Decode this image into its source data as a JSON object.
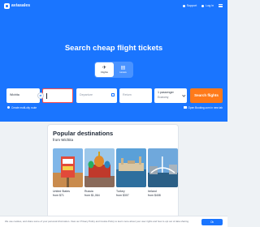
{
  "brand": {
    "name": "aviasales",
    "accent": "#1a75ff",
    "cta": "#ff7a1a"
  },
  "topbar": {
    "support_label": "Support",
    "account_label": "Log in"
  },
  "hero": {
    "headline": "Search cheap flight tickets"
  },
  "mode_tabs": [
    {
      "label": "Flights",
      "icon": "plane-icon",
      "active": true
    },
    {
      "label": "Hotels",
      "icon": "hotel-icon",
      "active": false
    }
  ],
  "search": {
    "from_value": "Wichita",
    "to_placeholder": "",
    "depart_placeholder": "Departure",
    "return_placeholder": "Return",
    "passengers_value": "1 passenger",
    "cabin_value": "Economy",
    "button_label": "Search flights"
  },
  "options": {
    "multi_city_label": "Create multi-city route",
    "booking_label": "Open Booking.com in new tab",
    "booking_checked": true
  },
  "popular": {
    "title": "Popular destinations",
    "subtitle": "from Wichita",
    "items": [
      {
        "name": "United States",
        "price": "from $71"
      },
      {
        "name": "Russia",
        "price": "from $1,064"
      },
      {
        "name": "Turkey",
        "price": "from $307"
      },
      {
        "name": "Ireland",
        "price": "from $408"
      }
    ],
    "all_label": "All destinations"
  },
  "cookie": {
    "text": "We use cookies, and share some of your personal information. View our Privacy Policy and Cookie Policy to learn more about your user rights and how to opt out of data sharing.",
    "button_label": "Ok"
  }
}
